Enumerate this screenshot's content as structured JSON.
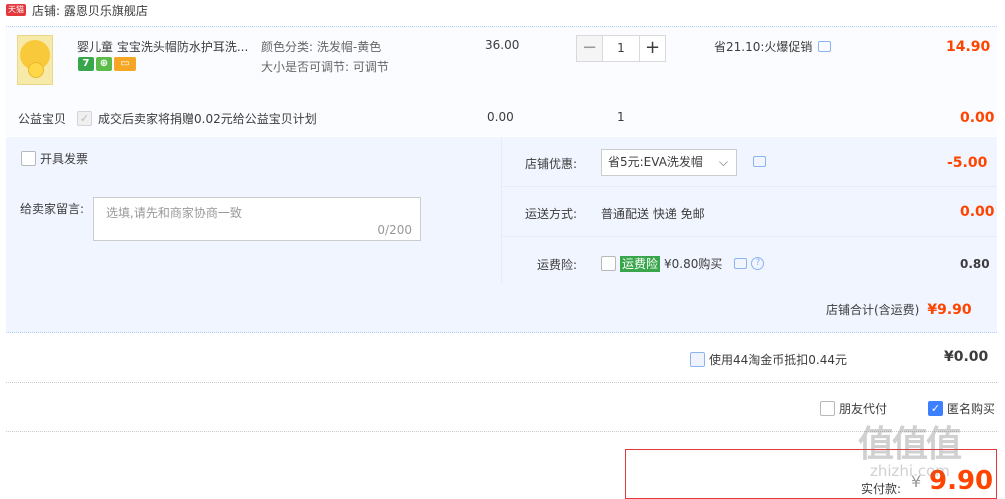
{
  "shop": {
    "badge": "天猫",
    "label": "店铺: 露恩贝乐旗舰店"
  },
  "item": {
    "title": "婴儿童 宝宝洗头帽防水护耳洗...",
    "color_attr": "颜色分类: 洗发帽-黄色",
    "size_attr": "大小是否可调节: 可调节",
    "unit_price": "36.00",
    "quantity": "1",
    "minus": "−",
    "plus": "+",
    "promo": "省21.10:火爆促销",
    "subtotal": "14.90",
    "badges": [
      "7",
      "⊕",
      "▭"
    ]
  },
  "charity": {
    "label": "公益宝贝",
    "text": "成交后卖家将捐赠0.02元给公益宝贝计划",
    "price": "0.00",
    "qty": "1",
    "subtotal": "0.00"
  },
  "invoice": {
    "label": "开具发票"
  },
  "message": {
    "label": "给卖家留言:",
    "placeholder": "选填,请先和商家协商一致",
    "counter": "0/200"
  },
  "shop_discount": {
    "label": "店铺优惠:",
    "value": "省5元:EVA洗发帽",
    "amount": "-5.00"
  },
  "shipping": {
    "label": "运送方式:",
    "value": "普通配送 快递 免邮",
    "amount": "0.00"
  },
  "insurance": {
    "label": "运费险:",
    "tag": "运费险",
    "text": "¥0.80购买",
    "amount": "0.80",
    "help": "?"
  },
  "shop_total": {
    "label": "店铺合计(含运费)",
    "amount": "¥9.90"
  },
  "coins": {
    "text": "使用44淘金币抵扣0.44元",
    "amount": "¥0.00"
  },
  "options": {
    "friend_pay": "朋友代付",
    "anonymous": "匿名购买"
  },
  "payment": {
    "label": "实付款:",
    "currency": "¥",
    "amount": "9.90"
  },
  "watermark": {
    "logo": "值值值",
    "url": "zhizhi.com"
  },
  "colors": {
    "price_red": "#ff4400",
    "accent_blue": "#3d80ff",
    "insurance_green": "#3aa64b"
  }
}
